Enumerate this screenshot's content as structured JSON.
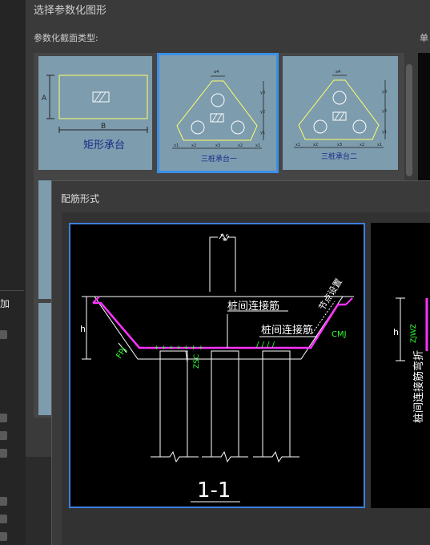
{
  "background_app": {
    "side_label": "加"
  },
  "shape_dialog": {
    "title": "选择参数化图形",
    "section_label": "参数化截面类型:",
    "right_label": "单",
    "shapes": [
      {
        "label": "矩形承台",
        "dim_a": "A",
        "dim_b": "B",
        "selected": false
      },
      {
        "label": "三桩承台一",
        "selected": true,
        "dims": [
          "a4",
          "y3",
          "y2",
          "y1",
          "x1",
          "x2",
          "x3",
          "x2",
          "x1"
        ]
      },
      {
        "label": "三桩承台二",
        "selected": false,
        "dims": [
          "a4",
          "y3",
          "y2",
          "y1",
          "x1",
          "x2",
          "x3",
          "x2",
          "x1"
        ]
      }
    ]
  },
  "rebar_dialog": {
    "title": "配筋形式",
    "main_drawing": {
      "section_label": "1-1",
      "labels": {
        "pile_link_bar": "桩间连接筋",
        "pile_link_bar_2": "桩间连接筋",
        "node_setting": "节点设置",
        "cmj": "CMJ",
        "fpj": "FPJ",
        "zsc": "ZSC",
        "h": "h"
      }
    },
    "second_drawing": {
      "labels": {
        "h": "h",
        "zjwz": "ZJWZ",
        "pile_link_bent": "桩间连接筋弯折"
      }
    }
  },
  "colors": {
    "selection": "#3c8fe6",
    "thumb_bg": "#7d9cae",
    "rebar": "#ff33ff",
    "annotation": "#33ff33",
    "drawing_line": "#ffffff",
    "shape_line": "#ffff66"
  }
}
